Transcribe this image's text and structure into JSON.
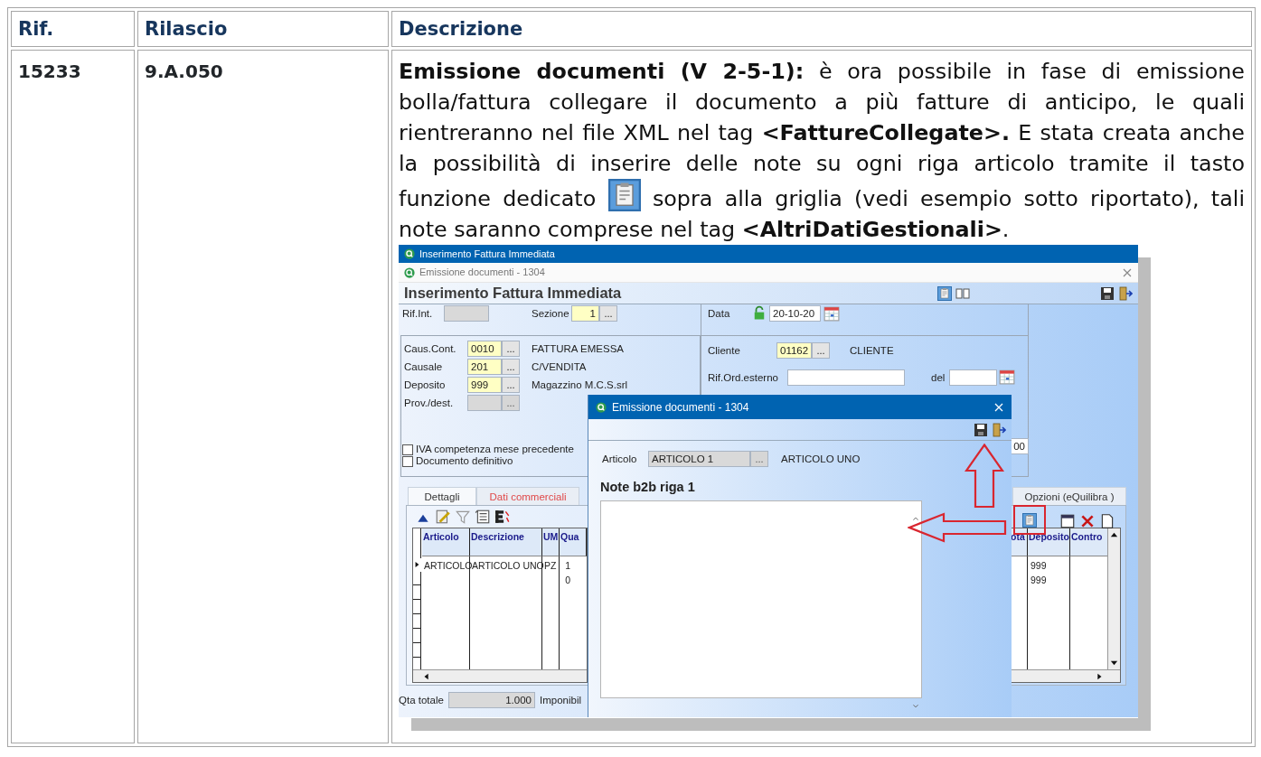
{
  "table": {
    "columns": [
      {
        "label": "Rif."
      },
      {
        "label": "Rilascio"
      },
      {
        "label": "Descrizione"
      }
    ],
    "rows": [
      {
        "rif": "15233",
        "release": "9.A.050",
        "description": {
          "text_before": "**Emissione documenti (V 2-5-1):** è ora possibile in fase di emissione bolla/fattura collegare il documento a più fatture di anticipo, le quali rientreranno nel file XML nel tag **<FattureCollegate>.** E stata creata anche la possibilità di inserire delle note su ogni riga articolo tramite il tasto funzione dedicato",
          "text_after": "sopra alla griglia (vedi esempio sotto riportato), tali note saranno comprese nel tag **<AltriDatiGestionali>**."
        },
        "screenshot": {
          "window_title": "Inserimento Fattura Immediata",
          "subtitle": "Emissione documenti - 1304",
          "form_title": "Inserimento Fattura Immediata",
          "rif_int": {
            "label": "Rif.Int."
          },
          "sezione": {
            "label": "Sezione",
            "value": "1",
            "button": "..."
          },
          "data": {
            "label": "Data",
            "value": "20-10-20"
          },
          "left_fields": [
            {
              "label": "Caus.Cont.",
              "value": "0010",
              "button": "...",
              "description": "FATTURA EMESSA",
              "disabled": false
            },
            {
              "label": "Causale",
              "value": "201",
              "button": "...",
              "description": "C/VENDITA",
              "disabled": false
            },
            {
              "label": "Deposito",
              "value": "999",
              "button": "...",
              "description": "Magazzino M.C.S.srl",
              "disabled": false
            },
            {
              "label": "Prov./dest.",
              "button": "...",
              "disabled": true
            }
          ],
          "checkboxes": [
            {
              "label": "IVA competenza mese precedente",
              "checked": false
            },
            {
              "label": "Documento definitivo",
              "checked": false
            }
          ],
          "cliente": {
            "label": "Cliente",
            "value": "01162",
            "button": "...",
            "description": "CLIENTE"
          },
          "rif_ord": {
            "label": "Rif.Ord.esterno",
            "date_label": "del"
          },
          "field_partial": "00",
          "tabs": [
            {
              "label": "Dettagli",
              "selected": true,
              "highlighted": false
            },
            {
              "label": "Dati commerciali",
              "selected": false,
              "highlighted": true
            },
            {
              "label": "Opzioni (eQuilibra )",
              "selected": false,
              "highlighted": false
            }
          ],
          "grid_left": {
            "columns": [
              "Articolo",
              "Descrizione",
              "UM",
              "Qua"
            ],
            "rows": [
              {
                "selected": true,
                "articolo": "ARTICOLO",
                "descrizione": "ARTICOLO UNO",
                "um": "PZ",
                "column_4": "1"
              },
              {
                "selected": false,
                "column_4": "0"
              }
            ]
          },
          "grid_right": {
            "columns": [
              "ota",
              "Deposito",
              "Contro"
            ],
            "rows": [
              {
                "deposito": "999"
              },
              {
                "deposito": "999"
              }
            ]
          },
          "totals": {
            "label": "Qta totale",
            "value": "1.000",
            "next_label": "Imponibil"
          },
          "dialog": {
            "title": "Emissione documenti - 1304",
            "article_label": "Articolo",
            "article_value": "ARTICOLO 1",
            "button": "...",
            "article_description": "ARTICOLO UNO",
            "note_label": "Note b2b riga 1"
          }
        }
      }
    ]
  }
}
